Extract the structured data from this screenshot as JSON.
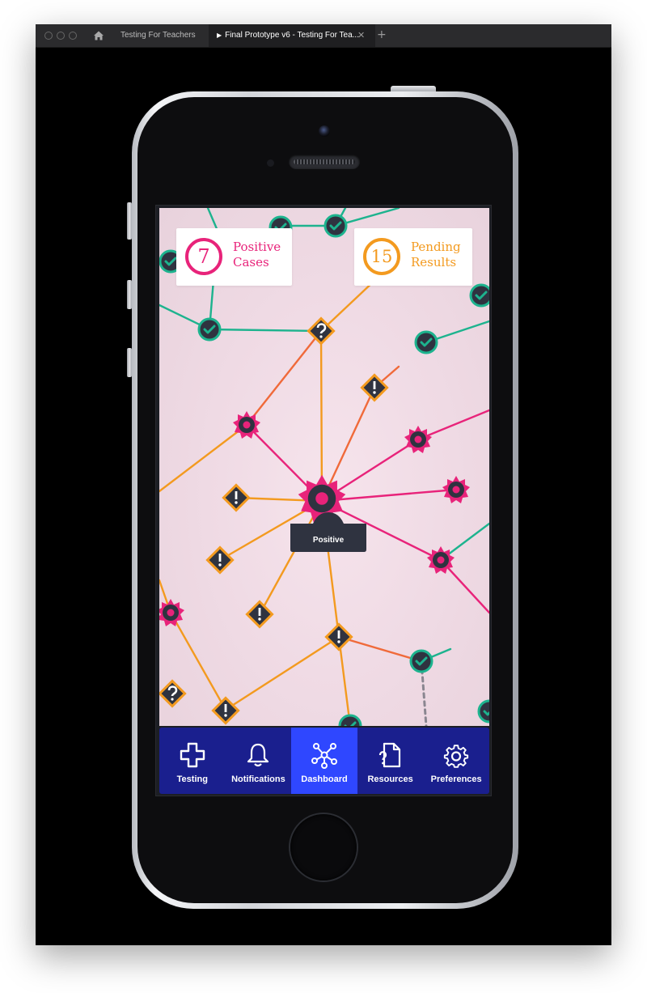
{
  "browser": {
    "tabs": [
      {
        "label": "Testing For Teachers"
      },
      {
        "label": "Final Prototype v6 - Testing For Tea..."
      }
    ]
  },
  "dashboard": {
    "stats": [
      {
        "value": "7",
        "label_line1": "Positive",
        "label_line2": "Cases",
        "color": "#e8237a"
      },
      {
        "value": "15",
        "label_line1": "Pending",
        "label_line2": "Results",
        "color": "#f39a1f"
      }
    ],
    "selected_node": {
      "label": "Positive"
    },
    "colors": {
      "positive": "#e8237a",
      "pending": "#f39a1f",
      "negative": "#1db38e",
      "node_fill": "#2f3340",
      "nav": "#1a1f8e",
      "nav_active": "#2f47ff"
    }
  },
  "nav": {
    "items": [
      {
        "label": "Testing",
        "icon": "plus-cross-icon"
      },
      {
        "label": "Notifications",
        "icon": "bell-icon"
      },
      {
        "label": "Dashboard",
        "icon": "network-icon",
        "active": true
      },
      {
        "label": "Resources",
        "icon": "document-question-icon"
      },
      {
        "label": "Preferences",
        "icon": "gear-icon"
      }
    ]
  }
}
